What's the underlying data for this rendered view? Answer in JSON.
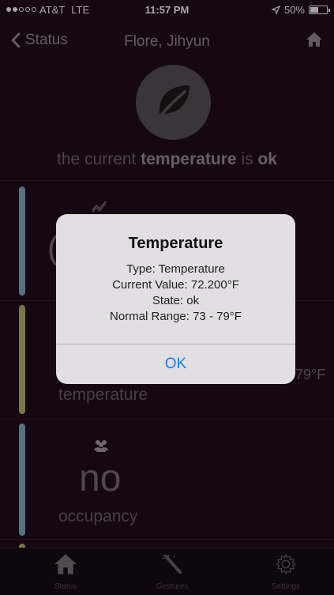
{
  "status_bar": {
    "carrier": "AT&T",
    "network": "LTE",
    "time": "11:57 PM",
    "battery": "50%",
    "signal_bars_filled": 2,
    "signal_bars_total": 5,
    "battery_level": 0.5
  },
  "nav": {
    "back_label": "Status",
    "title": "Flore, Jihyun",
    "icons": {
      "back": "chevron-left-icon",
      "home": "home-icon"
    }
  },
  "hero": {
    "icon": "leaf-icon",
    "msg_prefix": "the current",
    "msg_subject": "temperature",
    "msg_is": "is",
    "msg_state": "ok"
  },
  "cards": [
    {
      "id": "temperature-chart",
      "icon": "trend-chart-icon",
      "value_fragment": "(",
      "label": "",
      "bar_color": "#84aeca"
    },
    {
      "id": "temperature",
      "value_fragment": "79°F",
      "label": "temperature",
      "bar_color": "#b7b96a"
    },
    {
      "id": "occupancy",
      "icon": "people-icon",
      "value": "no",
      "label": "occupancy",
      "bar_color": "#84aeca"
    },
    {
      "id": "next",
      "bar_color": "#b7b96a"
    }
  ],
  "tabs": [
    {
      "id": "status",
      "label": "Status",
      "icon": "home-icon"
    },
    {
      "id": "gestures",
      "label": "Gestures",
      "icon": "magic-wand-icon"
    },
    {
      "id": "settings",
      "label": "Settings",
      "icon": "gear-icon"
    }
  ],
  "alert": {
    "title": "Temperature",
    "lines": [
      "Type: Temperature",
      "Current Value: 72.200°F",
      "State: ok",
      "Normal Range: 73 - 79°F"
    ],
    "ok_label": "OK"
  },
  "colors": {
    "background": "#210d1c",
    "accent_blue": "#84aeca",
    "accent_yellow": "#b7b96a",
    "alert_button": "#1a7cf5"
  }
}
